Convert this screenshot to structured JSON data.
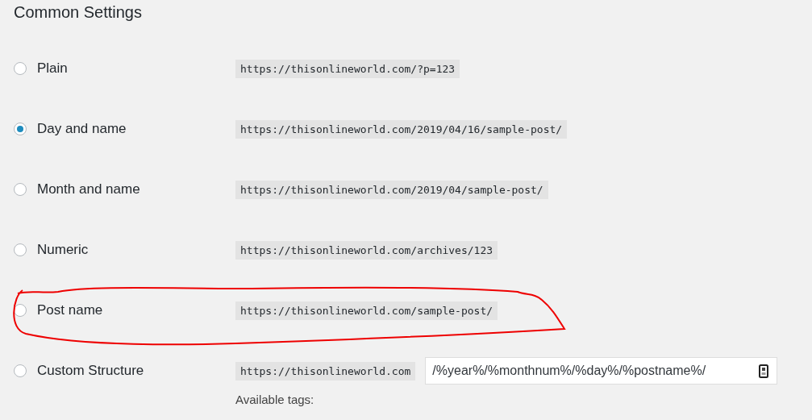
{
  "heading": "Common Settings",
  "options": [
    {
      "kind": "preset",
      "label": "Plain",
      "selected": false,
      "example": "https://thisonlineworld.com/?p=123",
      "annotated": false
    },
    {
      "kind": "preset",
      "label": "Day and name",
      "selected": true,
      "example": "https://thisonlineworld.com/2019/04/16/sample-post/",
      "annotated": false
    },
    {
      "kind": "preset",
      "label": "Month and name",
      "selected": false,
      "example": "https://thisonlineworld.com/2019/04/sample-post/",
      "annotated": false
    },
    {
      "kind": "preset",
      "label": "Numeric",
      "selected": false,
      "example": "https://thisonlineworld.com/archives/123",
      "annotated": false
    },
    {
      "kind": "preset",
      "label": "Post name",
      "selected": false,
      "example": "https://thisonlineworld.com/sample-post/",
      "annotated": true
    },
    {
      "kind": "custom",
      "label": "Custom Structure",
      "selected": false,
      "example": "https://thisonlineworld.com",
      "value": "/%year%/%monthnum%/%day%/%postname%/",
      "note": "Available tags:",
      "annotated": false
    }
  ]
}
